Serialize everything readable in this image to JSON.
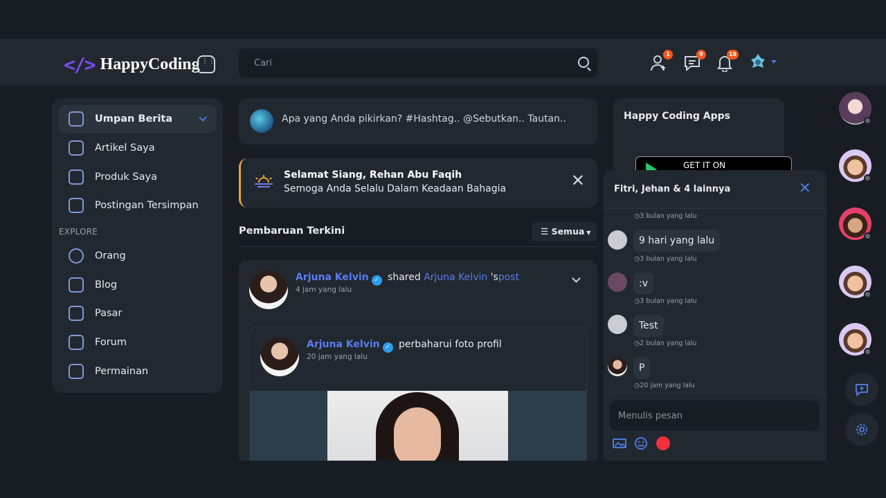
{
  "header": {
    "logo_mark": "</>",
    "logo_text": "HappyCoding",
    "search_placeholder": "Cari",
    "badges": {
      "friend_requests": "1",
      "messages": "9",
      "notifications": "18"
    }
  },
  "sidebar": {
    "items": [
      {
        "label": "Umpan Berita"
      },
      {
        "label": "Artikel Saya"
      },
      {
        "label": "Produk Saya"
      },
      {
        "label": "Postingan Tersimpan"
      }
    ],
    "explore_label": "EXPLORE",
    "explore_items": [
      {
        "label": "Orang"
      },
      {
        "label": "Blog"
      },
      {
        "label": "Pasar"
      },
      {
        "label": "Forum"
      },
      {
        "label": "Permainan"
      }
    ]
  },
  "composer": {
    "placeholder": "Apa yang Anda pikirkan? #Hashtag.. @Sebutkan.. Tautan.."
  },
  "greeting": {
    "title": "Selamat Siang, Rehan Abu Faqih",
    "subtitle": "Semoga Anda Selalu Dalam Keadaan Bahagia"
  },
  "feed": {
    "title": "Pembaruan Terkini",
    "filter_label": "Semua",
    "post": {
      "author": "Arjuna Kelvin",
      "action": "shared",
      "target_author": "Arjuna Kelvin",
      "target_suffix": "'s",
      "target_link": "post",
      "time": "4 jam yang lalu",
      "shared": {
        "author": "Arjuna Kelvin",
        "action": "perbaharui foto profil",
        "time": "20 jam yang lalu"
      }
    }
  },
  "apps": {
    "title": "Happy Coding Apps",
    "store_label": "GET IT ON"
  },
  "chat": {
    "title": "Fitri, Jehan & 4 lainnya",
    "top_time": "3 bulan yang lalu",
    "messages": [
      {
        "text": "9 hari yang lalu",
        "time": "3 bulan yang lalu"
      },
      {
        "text": ":v",
        "time": "3 bulan yang lalu"
      },
      {
        "text": "Test",
        "time": "2 bulan yang lalu"
      },
      {
        "text": "P",
        "time": "20 jam yang lalu"
      }
    ],
    "input_placeholder": "Menulis pesan"
  },
  "colors": {
    "accent": "#5b7cf0",
    "badge": "#f5571e",
    "greeting_border": "#e5a53a",
    "record": "#f0303c"
  }
}
